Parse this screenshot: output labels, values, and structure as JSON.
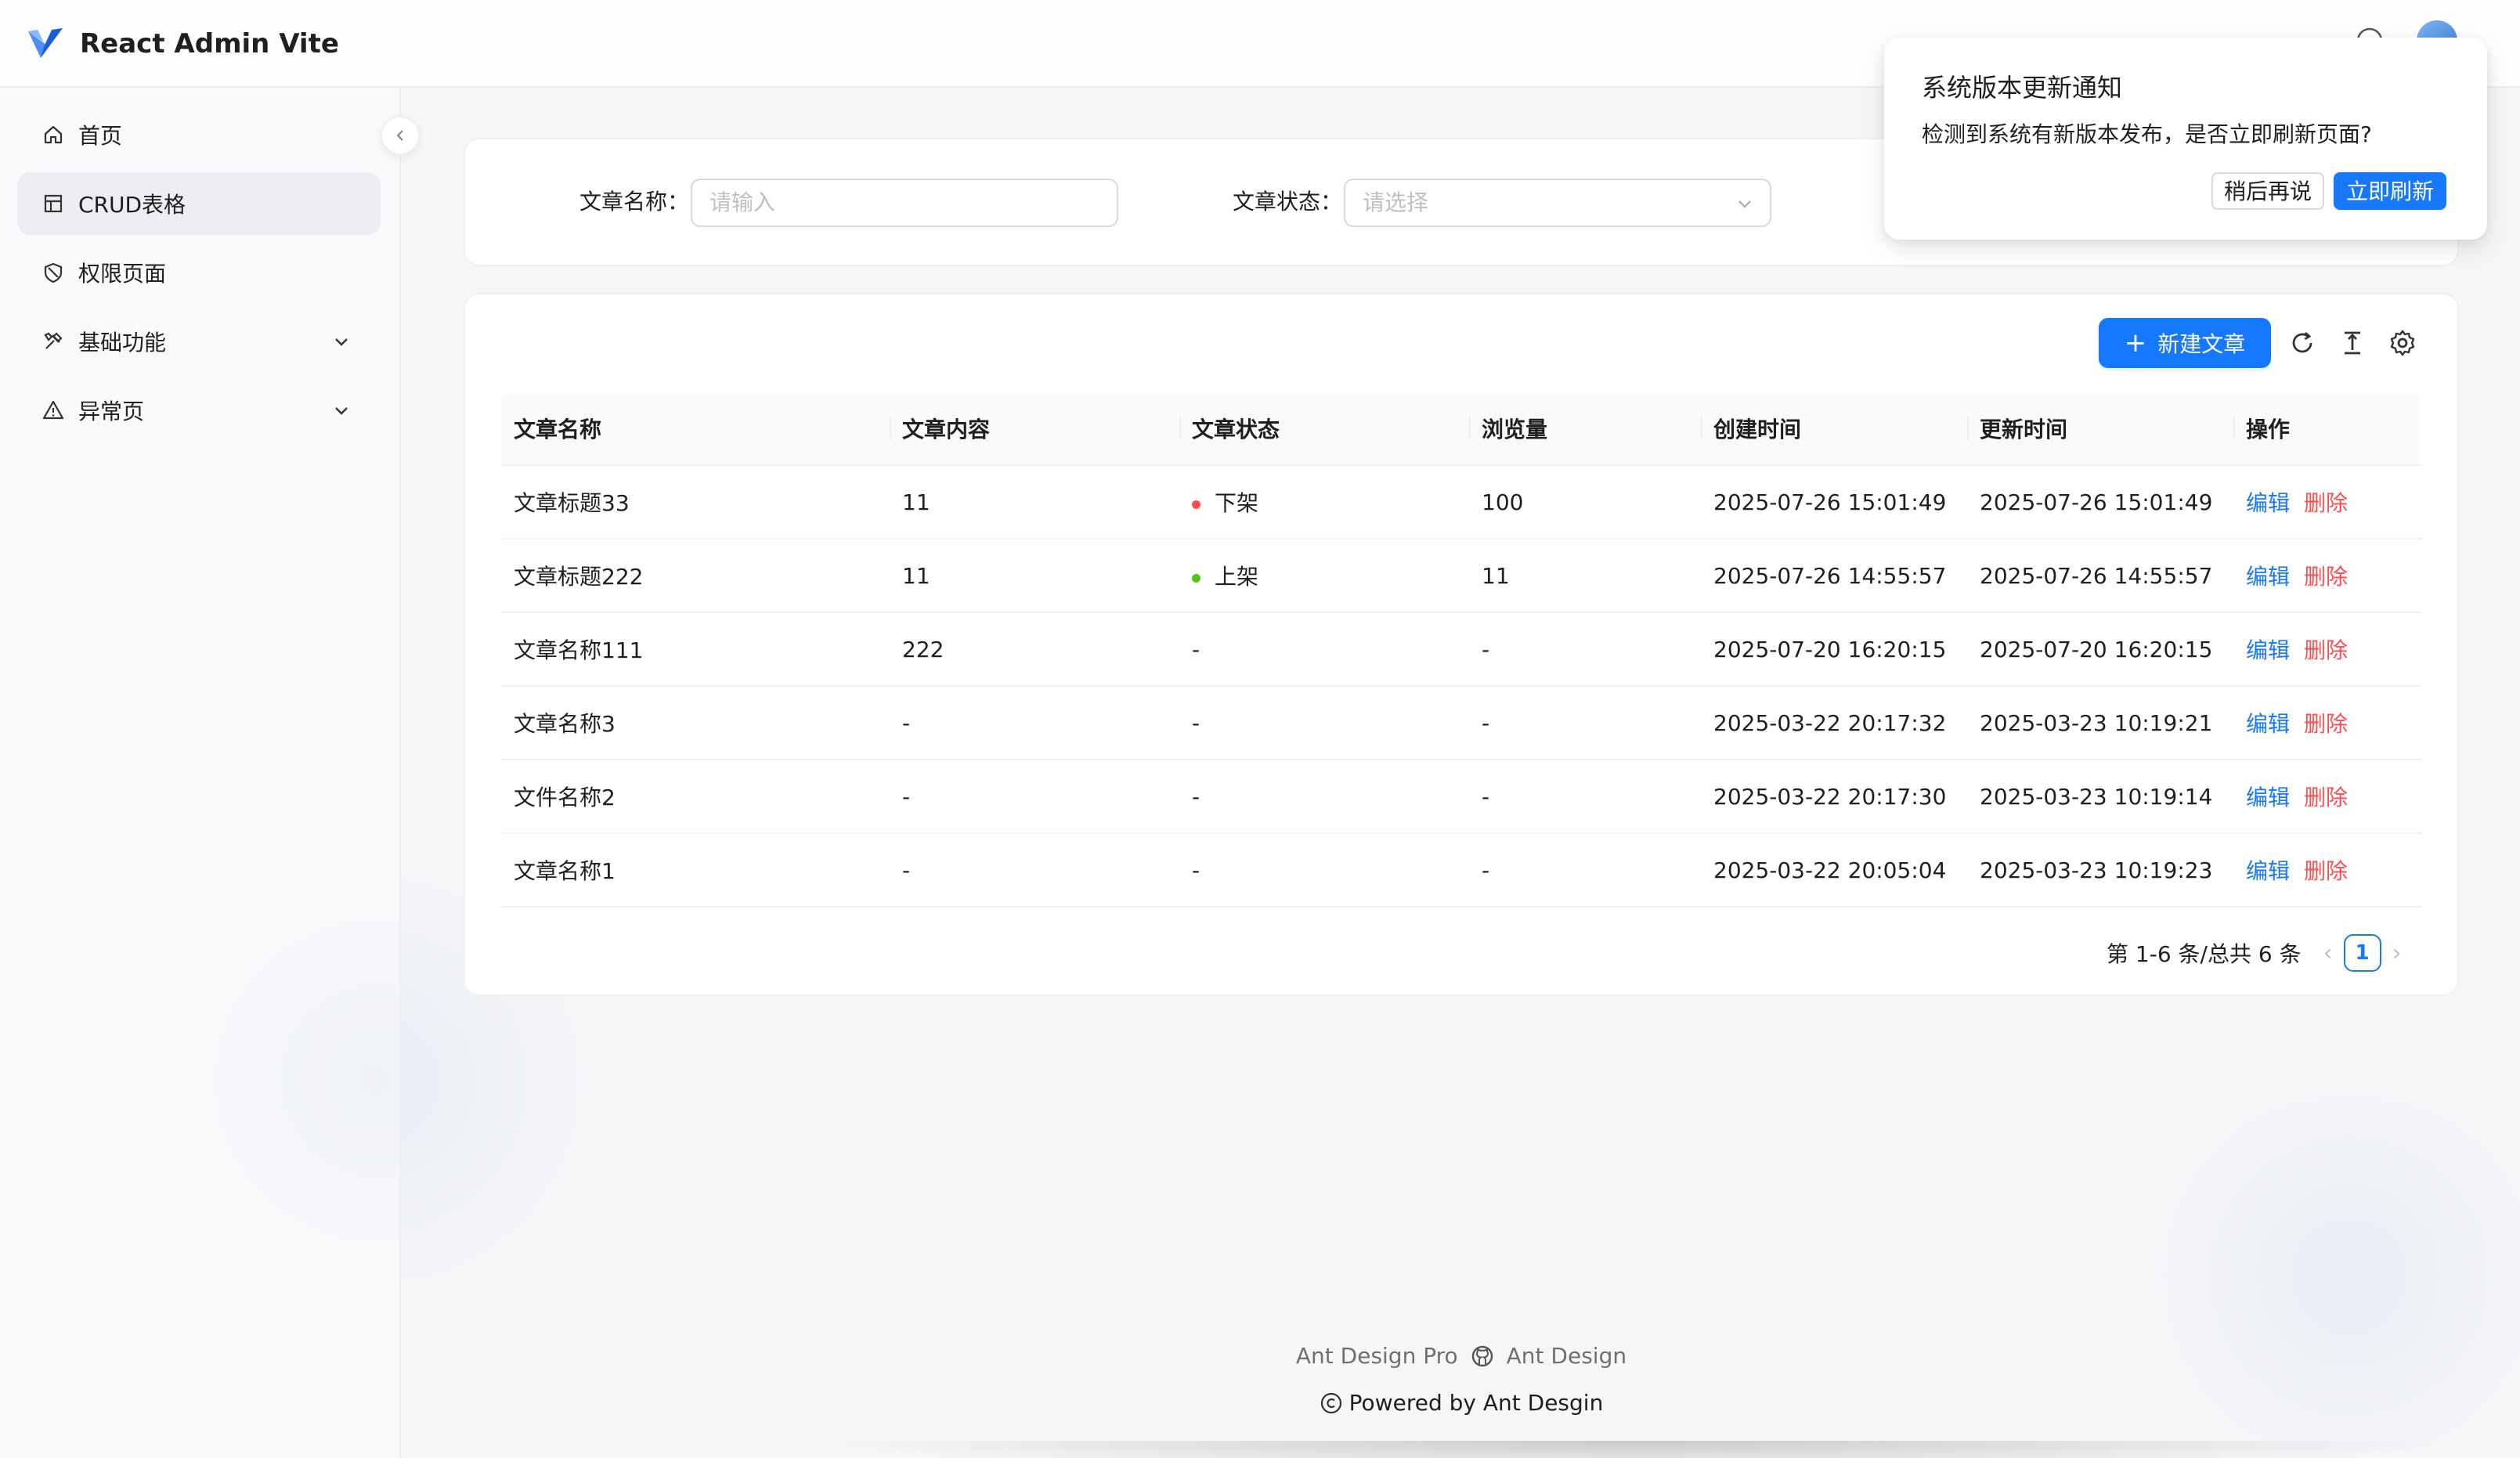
{
  "app": {
    "title": "React Admin Vite"
  },
  "sidebar": {
    "items": [
      {
        "label": "首页",
        "icon": "home-icon"
      },
      {
        "label": "CRUD表格",
        "icon": "table-icon",
        "active": true
      },
      {
        "label": "权限页面",
        "icon": "shield-icon"
      },
      {
        "label": "基础功能",
        "icon": "tools-icon",
        "expandable": true
      },
      {
        "label": "异常页",
        "icon": "warning-icon",
        "expandable": true
      }
    ]
  },
  "search": {
    "name_label": "文章名称",
    "name_placeholder": "请输入",
    "status_label": "文章状态",
    "status_placeholder": "请选择"
  },
  "toolbar": {
    "create_label": "新建文章"
  },
  "table": {
    "columns": [
      "文章名称",
      "文章内容",
      "文章状态",
      "浏览量",
      "创建时间",
      "更新时间",
      "操作"
    ],
    "rows": [
      {
        "name": "文章标题33",
        "content": "11",
        "status": "下架",
        "status_color": "#ff4d4f",
        "views": "100",
        "created": "2025-07-26 15:01:49",
        "updated": "2025-07-26 15:01:49"
      },
      {
        "name": "文章标题222",
        "content": "11",
        "status": "上架",
        "status_color": "#52c41a",
        "views": "11",
        "created": "2025-07-26 14:55:57",
        "updated": "2025-07-26 14:55:57"
      },
      {
        "name": "文章名称111",
        "content": "222",
        "status": "-",
        "status_color": "",
        "views": "-",
        "created": "2025-07-20 16:20:15",
        "updated": "2025-07-20 16:20:15"
      },
      {
        "name": "文章名称3",
        "content": "-",
        "status": "-",
        "status_color": "",
        "views": "-",
        "created": "2025-03-22 20:17:32",
        "updated": "2025-03-23 10:19:21"
      },
      {
        "name": "文件名称2",
        "content": "-",
        "status": "-",
        "status_color": "",
        "views": "-",
        "created": "2025-03-22 20:17:30",
        "updated": "2025-03-23 10:19:14"
      },
      {
        "name": "文章名称1",
        "content": "-",
        "status": "-",
        "status_color": "",
        "views": "-",
        "created": "2025-03-22 20:05:04",
        "updated": "2025-03-23 10:19:23"
      }
    ],
    "edit_label": "编辑",
    "delete_label": "删除"
  },
  "pagination": {
    "summary": "第 1-6 条/总共 6 条",
    "current_page": "1"
  },
  "notification": {
    "title": "系统版本更新通知",
    "description": "检测到系统有新版本发布，是否立即刷新页面?",
    "later_label": "稍后再说",
    "refresh_label": "立即刷新"
  },
  "footer": {
    "link1": "Ant Design Pro",
    "link2": "Ant Design",
    "copyright": "Powered by Ant Desgin"
  },
  "colors": {
    "primary": "#1677ff",
    "danger": "#ff4d4f",
    "success": "#52c41a"
  }
}
